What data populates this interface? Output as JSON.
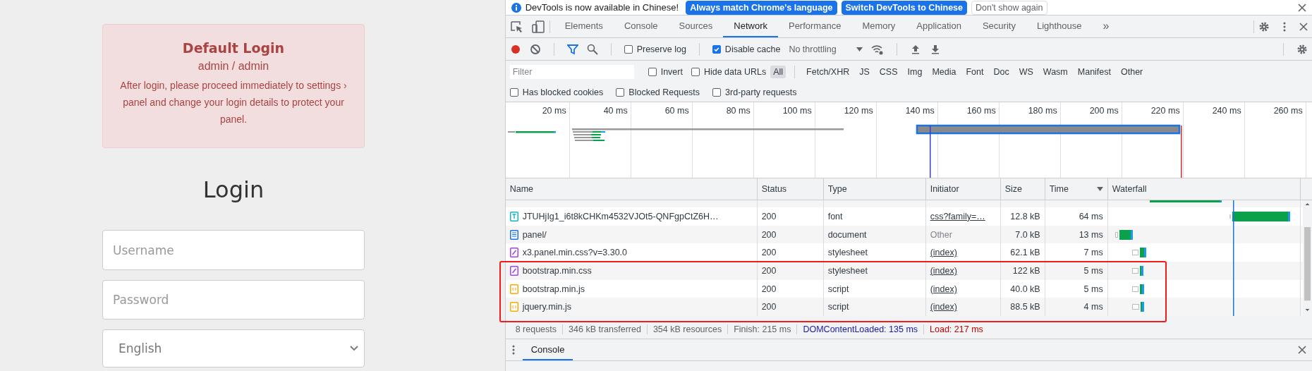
{
  "login_page": {
    "notice": {
      "title": "Default Login",
      "credentials": "admin / admin",
      "message": "After login, please proceed immediately to settings › panel and change your login details to protect your panel."
    },
    "heading": "Login",
    "username": {
      "placeholder": "Username"
    },
    "password": {
      "placeholder": "Password"
    },
    "language": {
      "value": "English"
    }
  },
  "devtools": {
    "infobar": {
      "message": "DevTools is now available in Chinese!",
      "buttons": [
        {
          "label": "Always match Chrome's language",
          "kind": "primary"
        },
        {
          "label": "Switch DevTools to Chinese",
          "kind": "primary"
        },
        {
          "label": "Don't show again",
          "kind": "plain"
        }
      ]
    },
    "tabs": [
      {
        "label": "Elements",
        "selected": false
      },
      {
        "label": "Console",
        "selected": false
      },
      {
        "label": "Sources",
        "selected": false
      },
      {
        "label": "Network",
        "selected": true
      },
      {
        "label": "Performance",
        "selected": false
      },
      {
        "label": "Memory",
        "selected": false
      },
      {
        "label": "Application",
        "selected": false
      },
      {
        "label": "Security",
        "selected": false
      },
      {
        "label": "Lighthouse",
        "selected": false
      }
    ],
    "more_tabs": "»",
    "toolbar": {
      "recording": true,
      "filter_active": true,
      "preserve_log": {
        "label": "Preserve log",
        "checked": false
      },
      "disable_cache": {
        "label": "Disable cache",
        "checked": true
      },
      "throttling": {
        "value": "No throttling"
      }
    },
    "filter": {
      "placeholder": "Filter",
      "invert": {
        "label": "Invert",
        "checked": false
      },
      "hide_data_urls": {
        "label": "Hide data URLs",
        "checked": false
      },
      "types": [
        {
          "label": "All",
          "selected": true
        },
        {
          "label": "Fetch/XHR",
          "selected": false
        },
        {
          "label": "JS",
          "selected": false
        },
        {
          "label": "CSS",
          "selected": false
        },
        {
          "label": "Img",
          "selected": false
        },
        {
          "label": "Media",
          "selected": false
        },
        {
          "label": "Font",
          "selected": false
        },
        {
          "label": "Doc",
          "selected": false
        },
        {
          "label": "WS",
          "selected": false
        },
        {
          "label": "Wasm",
          "selected": false
        },
        {
          "label": "Manifest",
          "selected": false
        },
        {
          "label": "Other",
          "selected": false
        }
      ],
      "options": [
        {
          "label": "Has blocked cookies",
          "checked": false
        },
        {
          "label": "Blocked Requests",
          "checked": false
        },
        {
          "label": "3rd-party requests",
          "checked": false
        }
      ]
    },
    "overview": {
      "ticks": [
        "20 ms",
        "40 ms",
        "60 ms",
        "80 ms",
        "100 ms",
        "120 ms",
        "140 ms",
        "160 ms",
        "180 ms",
        "200 ms",
        "220 ms",
        "240 ms",
        "260 ms"
      ]
    },
    "table": {
      "columns": [
        "Name",
        "Status",
        "Type",
        "Initiator",
        "Size",
        "Time",
        "Waterfall"
      ],
      "rows": [
        {
          "name": "JTUHjIg1_i6t8kCHKm4532VJOt5-QNFgpCtZ6H…",
          "status": "200",
          "type": "font",
          "kind": "font",
          "initiator": "css?family=…",
          "initiator_link": true,
          "size": "12.8 kB",
          "time": "64 ms",
          "highlighted": false
        },
        {
          "name": "panel/",
          "status": "200",
          "type": "document",
          "kind": "document",
          "initiator": "Other",
          "initiator_link": false,
          "size": "7.0 kB",
          "time": "13 ms",
          "highlighted": false
        },
        {
          "name": "x3.panel.min.css?v=3.30.0",
          "status": "200",
          "type": "stylesheet",
          "kind": "stylesheet",
          "initiator": "(index)",
          "initiator_link": true,
          "size": "62.1 kB",
          "time": "7 ms",
          "highlighted": false
        },
        {
          "name": "bootstrap.min.css",
          "status": "200",
          "type": "stylesheet",
          "kind": "stylesheet",
          "initiator": "(index)",
          "initiator_link": true,
          "size": "122 kB",
          "time": "5 ms",
          "highlighted": true
        },
        {
          "name": "bootstrap.min.js",
          "status": "200",
          "type": "script",
          "kind": "script",
          "initiator": "(index)",
          "initiator_link": true,
          "size": "40.0 kB",
          "time": "5 ms",
          "highlighted": true
        },
        {
          "name": "jquery.min.js",
          "status": "200",
          "type": "script",
          "kind": "script",
          "initiator": "(index)",
          "initiator_link": true,
          "size": "88.5 kB",
          "time": "4 ms",
          "highlighted": true
        }
      ]
    },
    "summary": [
      {
        "text": "8 requests",
        "kind": "plain"
      },
      {
        "text": "346 kB transferred",
        "kind": "plain"
      },
      {
        "text": "354 kB resources",
        "kind": "plain"
      },
      {
        "text": "Finish: 215 ms",
        "kind": "plain"
      },
      {
        "text": "DOMContentLoaded: 135 ms",
        "kind": "dom"
      },
      {
        "text": "Load: 217 ms",
        "kind": "load"
      }
    ],
    "drawer": {
      "tabs": [
        {
          "label": "Console",
          "selected": true
        }
      ]
    }
  }
}
